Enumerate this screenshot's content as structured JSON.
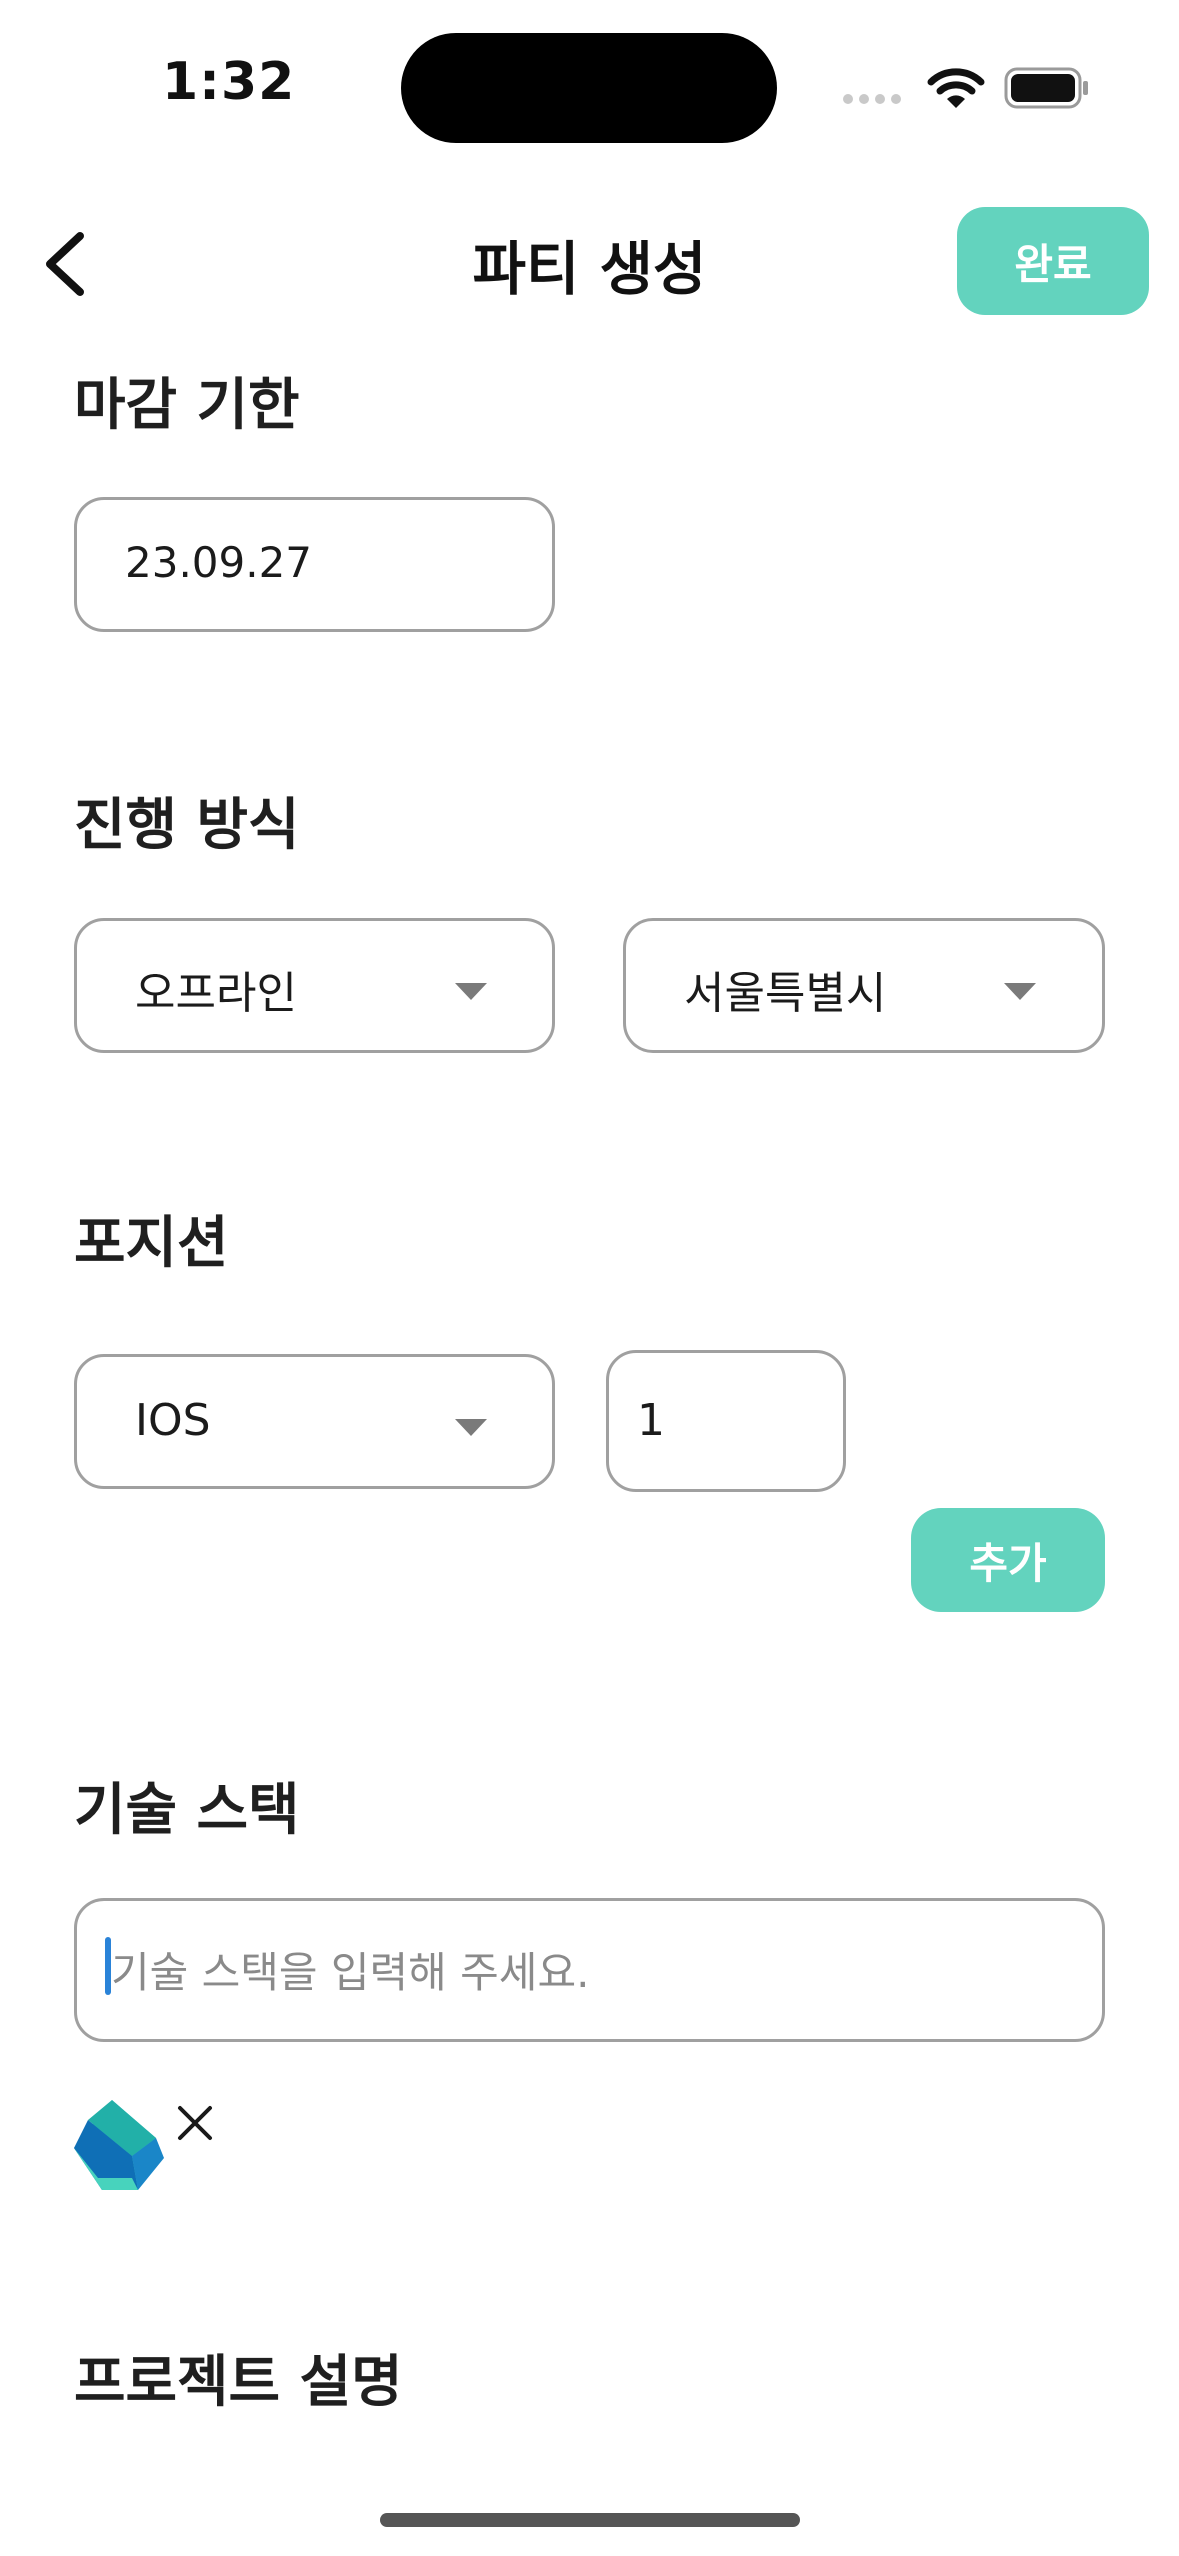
{
  "status_bar": {
    "time": "1:32",
    "icons": [
      "cellular-dots-icon",
      "wifi-icon",
      "battery-icon"
    ]
  },
  "nav": {
    "back_icon": "chevron-left-icon",
    "title": "파티 생성",
    "done_label": "완료"
  },
  "deadline": {
    "title": "마감 기한",
    "value": "23.09.27"
  },
  "method": {
    "title": "진행 방식",
    "mode_selected": "오프라인",
    "region_selected": "서울특별시"
  },
  "position": {
    "title": "포지션",
    "role_selected": "IOS",
    "count_value": "1",
    "add_label": "추가"
  },
  "tech_stack": {
    "title": "기술 스택",
    "placeholder": "기술 스택을 입력해 주세요.",
    "chips": [
      {
        "icon": "dart-logo-icon",
        "remove_icon": "close-icon",
        "remove_label": "×"
      }
    ]
  },
  "project": {
    "title": "프로젝트 설명"
  },
  "colors": {
    "accent": "#63d3be",
    "border": "#a0a0a0",
    "cursor": "#2a83d8"
  }
}
